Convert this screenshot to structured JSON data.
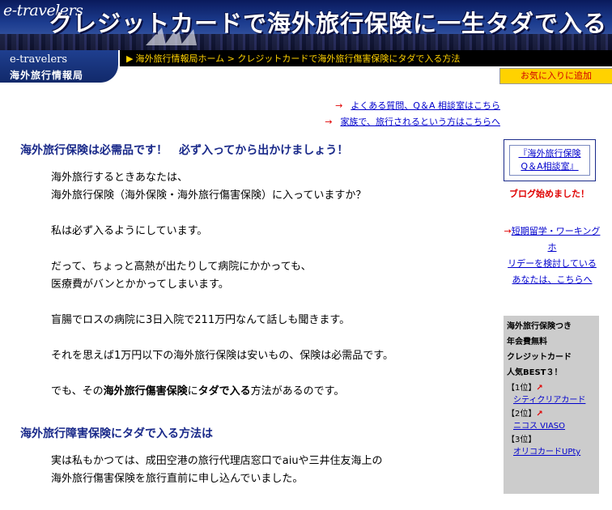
{
  "header": {
    "brand_small": "e-travelers",
    "title": "クレジットカードで海外旅行保険に一生タダで入る",
    "logo_top": "e-travelers",
    "logo_bottom": "海外旅行情報局",
    "breadcrumb_home": "海外旅行情報局ホーム",
    "breadcrumb_sep": ">",
    "breadcrumb_current": "クレジットカードで海外旅行傷害保険にタダで入る方法",
    "favorite_button": "お気に入りに追加"
  },
  "top_links": [
    {
      "arrow": "→",
      "label": "よくある質問、Q＆A 相談室はこちら"
    },
    {
      "arrow": "→",
      "label": "家族で、旅行されるという方はこちらへ"
    }
  ],
  "main": {
    "heading1": "海外旅行保険は必需品です！　必ず入ってから出かけましょう！",
    "p1_line1": "海外旅行するときあなたは、",
    "p1_line2": "海外旅行保険（海外保険・海外旅行傷害保険）に入っていますか？",
    "p2": "私は必ず入るようにしています。",
    "p3_line1": "だって、ちょっと高熱が出たりして病院にかかっても、",
    "p3_line2": "医療費がバンとかかってしまいます。",
    "p4": "盲腸でロスの病院に3日入院で211万円なんて話しも聞きます。",
    "p5": "それを思えば1万円以下の海外旅行保険は安いもの、保険は必需品です。",
    "p6_pre": "でも、その",
    "p6_bold1": "海外旅行傷害保険",
    "p6_mid": "に",
    "p6_bold2": "タダで入る",
    "p6_post": "方法があるのです。",
    "heading2": "海外旅行障害保険にタダで入る方法は",
    "p7_line1": "実は私もかつては、成田空港の旅行代理店窓口でaiuや三井住友海上の",
    "p7_line2": "海外旅行傷害保険を旅行直前に申し込んでいました。"
  },
  "side": {
    "qa_line1": "『海外旅行保険",
    "qa_line2": "Q＆A相談室』",
    "blog": "ブログ始めました！",
    "study_arrow": "→",
    "study_line1": "短期留学・ワーキングホ",
    "study_line2": "リデーを検討している",
    "study_line3": "あなたは、こちらへ",
    "rank_title1": "海外旅行保険つき",
    "rank_title2": "年会費無料",
    "rank_title3": "クレジットカード",
    "rank_title4": "人気BEST３！",
    "ranks": [
      {
        "pos": "【1位】",
        "name": "シティクリアカード"
      },
      {
        "pos": "【2位】",
        "name": "ニコス VIASO"
      },
      {
        "pos": "【3位】",
        "name": "オリコカードUPty"
      }
    ]
  },
  "colors": {
    "accent_red": "#e00000",
    "link_blue": "#0000cc",
    "heading_navy": "#1a2a8a",
    "favorite_bg": "#ffd200"
  }
}
